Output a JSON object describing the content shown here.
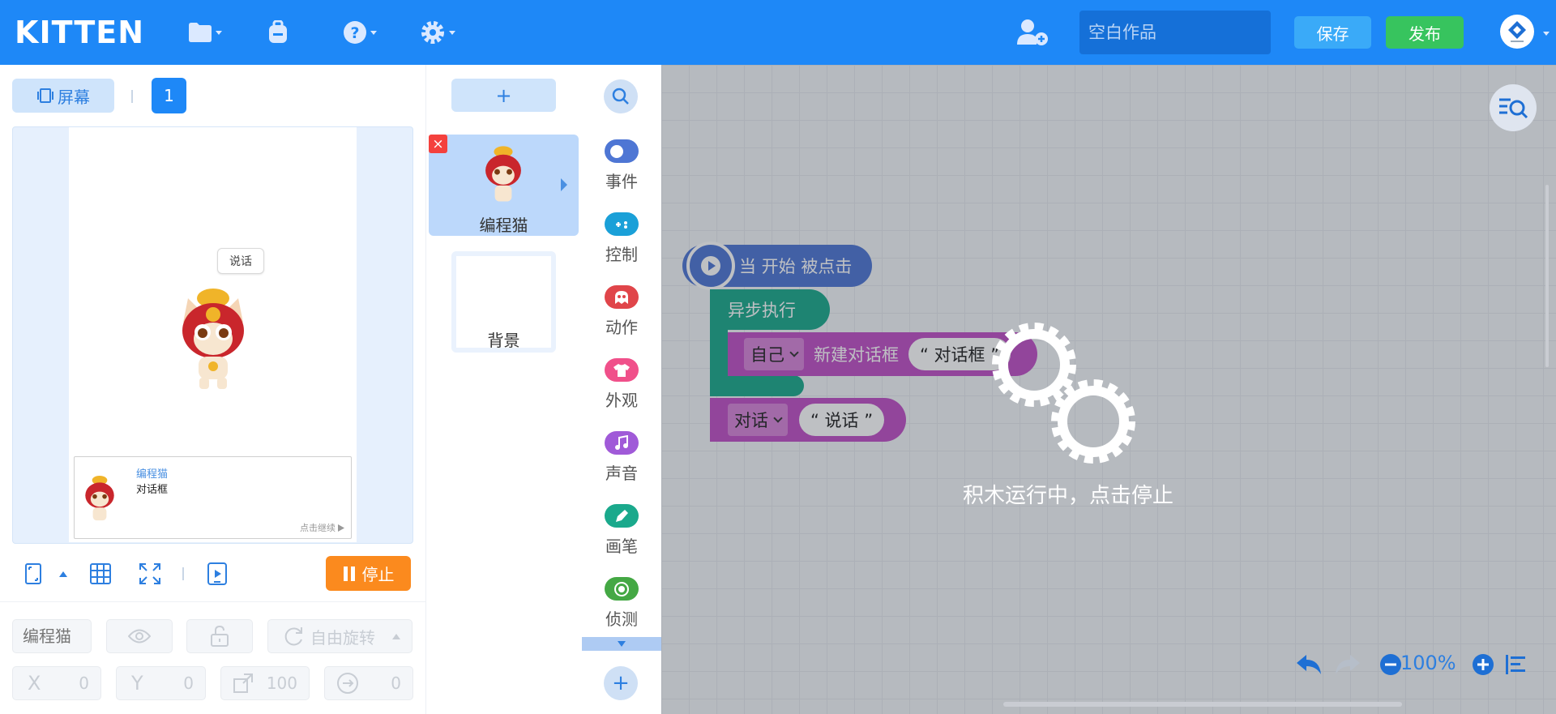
{
  "app": {
    "logo": "KITTEN",
    "title_placeholder": "空白作品",
    "save_label": "保存",
    "publish_label": "发布"
  },
  "stage": {
    "screen_button_label": "屏幕",
    "screen_number": "1",
    "speech_bubble": "说话",
    "dialog_name": "编程猫",
    "dialog_text": "对话框",
    "dialog_continue": "点击继续",
    "stop_label": "停止"
  },
  "properties": {
    "sprite_name_placeholder": "编程猫",
    "rotation_mode": "自由旋转",
    "x_label": "X",
    "x_value": "0",
    "y_label": "Y",
    "y_value": "0",
    "size_value": "100",
    "direction_value": "0"
  },
  "sprites": {
    "add_label": "+",
    "items": [
      {
        "name": "编程猫",
        "selected": true
      }
    ],
    "background_label": "背景"
  },
  "categories": [
    {
      "label": "事件",
      "color": "#4e76d4",
      "icon": "toggle-icon"
    },
    {
      "label": "控制",
      "color": "#1aa0d8",
      "icon": "gamepad-icon"
    },
    {
      "label": "动作",
      "color": "#e0454a",
      "icon": "ghost-icon"
    },
    {
      "label": "外观",
      "color": "#f0508a",
      "icon": "shirt-icon"
    },
    {
      "label": "声音",
      "color": "#a05ad8",
      "icon": "music-icon"
    },
    {
      "label": "画笔",
      "color": "#1aa98c",
      "icon": "pen-icon"
    },
    {
      "label": "侦测",
      "color": "#44a844",
      "icon": "radar-icon"
    }
  ],
  "blocks": {
    "event_label": "当 开始 被点击",
    "async_label": "异步执行",
    "dialog_target": "自己",
    "dialog_action": "新建对话框",
    "dialog_value": "“ 对话框 ”",
    "say_dropdown": "对话",
    "say_value": "“ 说话 ”"
  },
  "workspace": {
    "running_text": "积木运行中，点击停止",
    "zoom_level": "100%"
  }
}
